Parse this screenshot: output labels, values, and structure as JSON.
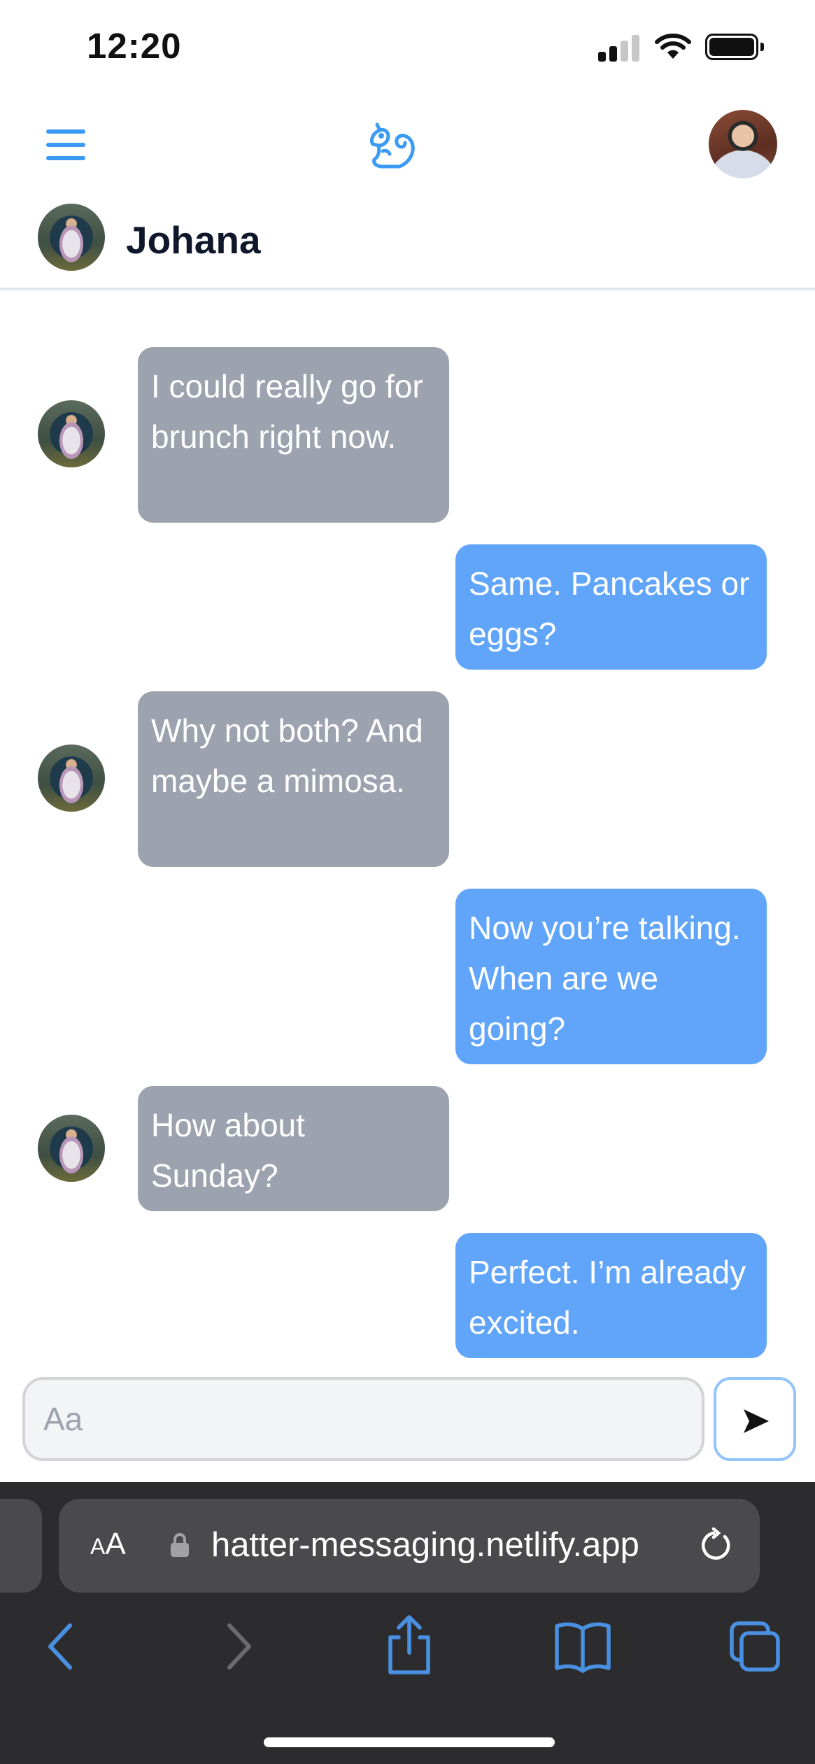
{
  "status_bar": {
    "time": "12:20"
  },
  "header": {
    "menu_icon": "hamburger-menu-icon",
    "logo_icon": "squirrel-logo-icon",
    "user_avatar": "user-avatar"
  },
  "conversation": {
    "contact_name": "Johana"
  },
  "messages": [
    {
      "direction": "incoming",
      "text": "I could really go for brunch right now."
    },
    {
      "direction": "outgoing",
      "text": "Same. Pancakes or eggs?"
    },
    {
      "direction": "incoming",
      "text": "Why not both? And maybe a mimosa."
    },
    {
      "direction": "outgoing",
      "text": "Now you’re talking. When are we going?"
    },
    {
      "direction": "incoming",
      "text": "How about Sunday?"
    },
    {
      "direction": "outgoing",
      "text": "Perfect. I’m already excited."
    }
  ],
  "composer": {
    "placeholder": "Aa",
    "value": "",
    "send_icon": "send-arrow-icon"
  },
  "browser": {
    "aa_label_small": "A",
    "aa_label_large": "A",
    "url": "hatter-messaging.netlify.app",
    "toolbar_icons": [
      "back-icon",
      "forward-icon",
      "share-icon",
      "bookmarks-icon",
      "tabs-icon"
    ]
  },
  "colors": {
    "accent": "#3b9af3",
    "incoming_bubble": "#9ca3af",
    "outgoing_bubble": "#60a5fa",
    "browser_chrome": "#2c2c2e",
    "browser_icon_blue": "#4a90e2"
  }
}
